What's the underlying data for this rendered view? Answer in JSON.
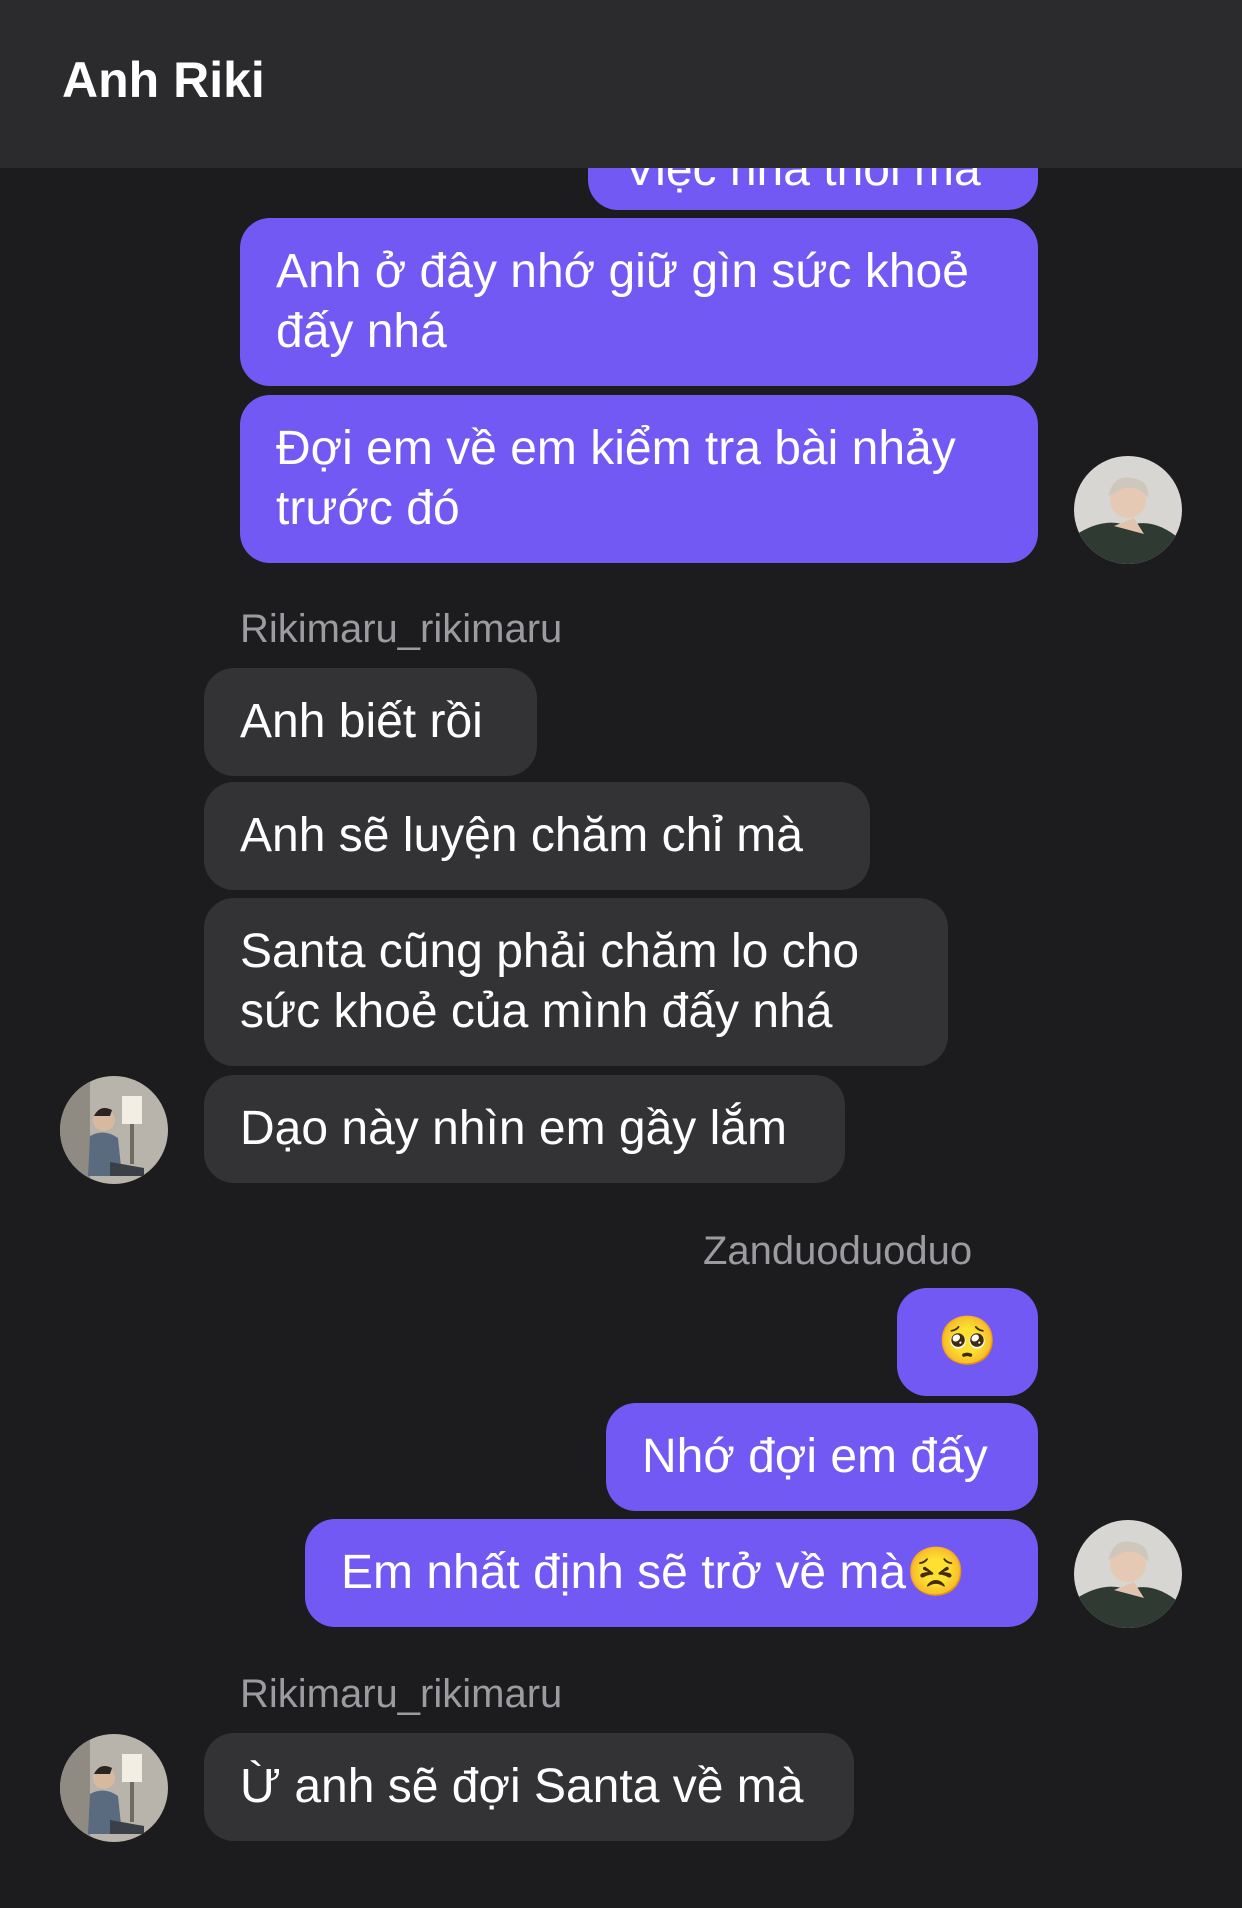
{
  "header": {
    "title": "Anh Riki"
  },
  "messages": {
    "m0": "Việc nhà thôi mà",
    "m1": "Anh ở đây nhớ giữ gìn sức khoẻ đấy nhá",
    "m2": "Đợi em về em kiểm tra bài nhảy trước đó",
    "sender1": "Rikimaru_rikimaru",
    "m3": "Anh biết rồi",
    "m4": "Anh sẽ luyện chăm chỉ mà",
    "m5": "Santa cũng phải chăm lo cho sức khoẻ của mình đấy nhá",
    "m6": "Dạo này nhìn em gầy lắm",
    "sender2": "Zanduoduoduo",
    "m7": "🥺",
    "m8": "Nhớ đợi em đấy",
    "m9": "Em nhất định sẽ trở về mà😣",
    "sender3": "Rikimaru_rikimaru",
    "m10": "Ừ anh sẽ đợi Santa về mà"
  },
  "colors": {
    "outgoing_bubble": "#7259f4",
    "incoming_bubble": "#333335",
    "background": "#1c1c1e",
    "header": "#2b2b2d",
    "sender_name": "#9b9ba0"
  }
}
